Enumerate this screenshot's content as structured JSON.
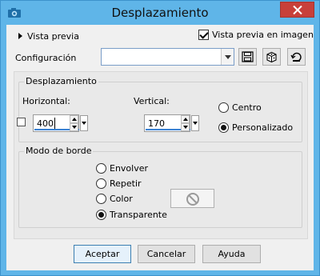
{
  "window": {
    "title": "Desplazamiento"
  },
  "header": {
    "preview_toggle_label": "Vista previa",
    "preview_in_image_label": "Vista previa en imagen",
    "preview_in_image_checked": true
  },
  "config": {
    "label": "Configuración",
    "value": ""
  },
  "offset": {
    "group_title": "Desplazamiento",
    "horizontal_label": "Horizontal:",
    "horizontal_value": "400",
    "vertical_label": "Vertical:",
    "vertical_value": "170",
    "center_label": "Centro",
    "custom_label": "Personalizado",
    "selected": "custom"
  },
  "edge_mode": {
    "group_title": "Modo de borde",
    "options": [
      "Envolver",
      "Repetir",
      "Color",
      "Transparente"
    ],
    "selected": "Transparente"
  },
  "buttons": {
    "accept": "Aceptar",
    "cancel": "Cancelar",
    "help": "Ayuda"
  },
  "colors": {
    "titlebar": "#5fb5e8",
    "close": "#c8403a",
    "accent": "#3b82d4"
  }
}
